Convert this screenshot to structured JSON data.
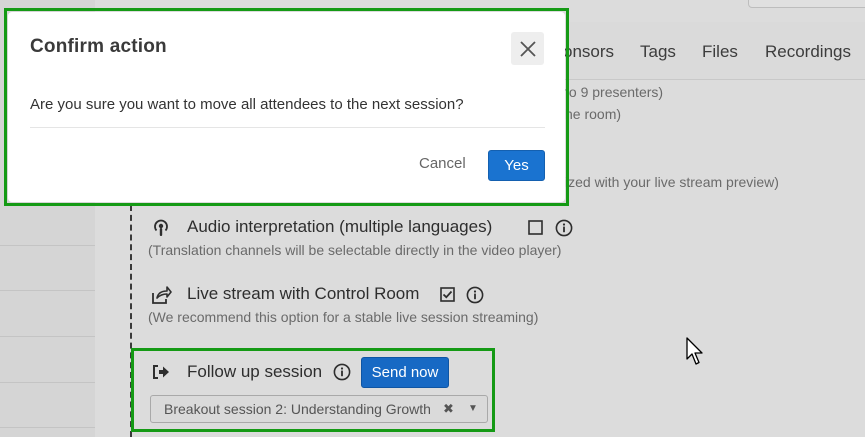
{
  "tabs": [
    "onsors",
    "Tags",
    "Files",
    "Recordings"
  ],
  "background_options": {
    "partial_lines": [
      "to 9 presenters)",
      "he room)",
      "ized with your live stream preview)"
    ],
    "audio_interpretation": {
      "title": "Audio interpretation (multiple languages)",
      "description": "(Translation channels will be selectable directly in the video player)",
      "checked": false
    },
    "live_stream": {
      "title": "Live stream with Control Room",
      "description": "(We recommend this option for a stable live session streaming)",
      "checked": true
    },
    "follow_up": {
      "title": "Follow up session",
      "send_button": "Send now",
      "selected_session": "Breakout session 2: Understanding Growth",
      "clear_glyph": "✖",
      "dropdown_glyph": "▼"
    }
  },
  "modal": {
    "title": "Confirm action",
    "message": "Are you sure you want to move all attendees to the next session?",
    "cancel_label": "Cancel",
    "confirm_label": "Yes"
  },
  "colors": {
    "accent_blue": "#1a73d0",
    "highlight_green": "#159a15"
  },
  "icons": {
    "audio": "podcast-icon",
    "live_stream": "share-icon",
    "follow_up": "sign-out-icon",
    "info": "info-icon",
    "close": "close-icon"
  }
}
